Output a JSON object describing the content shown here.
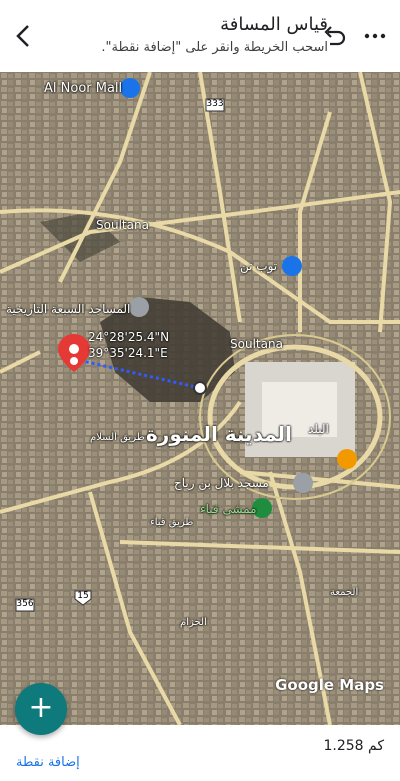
{
  "header": {
    "title": "قياس المسافة",
    "subtitle": "اسحب الخريطة وانقر على \"إضافة نقطة\".",
    "back_icon": "chevron-left-icon",
    "undo_icon": "undo-icon",
    "more_icon": "more-horiz-icon"
  },
  "map": {
    "places": {
      "al_noor_mall": "Al Noor Mall",
      "toyoto": "توب تن",
      "masajid": "المساجد السبعة التاريخية",
      "madinah": "المدينة المنورة",
      "balad": "البلد",
      "bilal": "مسجد بلال بن رباح",
      "mamsha": "ممشى قباء",
      "soultana_1": "Soultana",
      "soultana_2": "Soultana",
      "road_333": "333",
      "road_356": "356",
      "road_15": "15",
      "salam": "طريق السلام",
      "quba": "طريق قباء",
      "jumuah": "الجمعة",
      "alhizam": "الحزام"
    },
    "coordinates": {
      "lat": "24°28'25.4\"N",
      "lng": "39°35'24.1\"E"
    },
    "attribution": "Google Maps"
  },
  "footer": {
    "add_point_label": "إضافة نقطة",
    "distance": "1.258 كم",
    "add_icon": "plus-icon"
  },
  "colors": {
    "fab": "#0e7a7b",
    "link": "#1a73e8",
    "measure_line": "#2f5bff",
    "pin": "#e53935"
  }
}
